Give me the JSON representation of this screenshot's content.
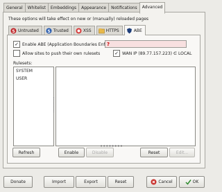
{
  "tabs": [
    "General",
    "Whitelist",
    "Embeddings",
    "Appearance",
    "Notifications",
    "Advanced"
  ],
  "notice": "These options will take effect on new or (manually) reloaded pages",
  "subtabs": [
    "Untrusted",
    "Trusted",
    "XSS",
    "HTTPS",
    "ABE"
  ],
  "abe": {
    "enable_label": "Enable ABE (Application Boundaries Enforcer)",
    "enable_checked": true,
    "allow_sites_label": "Allow sites to push their own rulesets",
    "allow_sites_checked": false,
    "wan_ip_label": "WAN IP (89.77.157.223) ∈ LOCAL",
    "wan_ip_checked": true,
    "help_glyph": "?",
    "rulesets_label": "Rulesets:",
    "rulesets": [
      "SYSTEM",
      "USER"
    ],
    "buttons": {
      "refresh": "Refresh",
      "enable": "Enable",
      "disable": "Disable",
      "reset": "Reset",
      "edit": "Edit..."
    }
  },
  "footer": {
    "donate": "Donate",
    "import": "Import",
    "export": "Export",
    "reset": "Reset",
    "cancel": "Cancel",
    "ok": "OK"
  }
}
